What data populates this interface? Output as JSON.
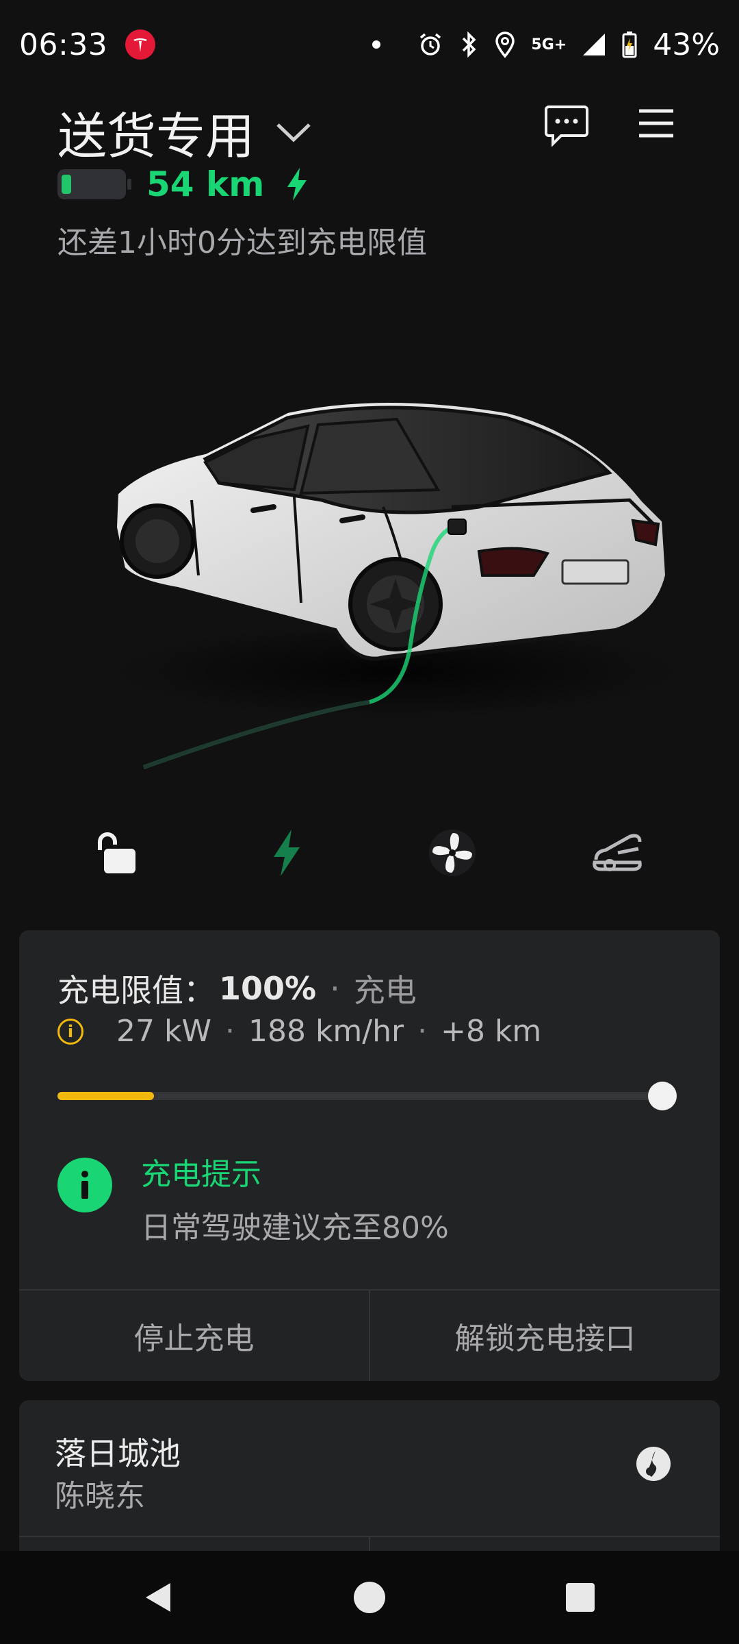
{
  "status_bar": {
    "time": "06:33",
    "network": "5G+",
    "battery_percent": "43%",
    "icons": [
      "tesla-app-icon",
      "dot-icon",
      "alarm-icon",
      "bluetooth-icon",
      "location-icon",
      "signal-icon",
      "battery-icon"
    ]
  },
  "header": {
    "vehicle_name": "送货专用",
    "range": "54 km",
    "charge_eta": "还差1小时0分达到充电限值"
  },
  "quick_controls": {
    "icons": [
      "unlock-icon",
      "charge-icon",
      "fan-icon",
      "trunk-icon"
    ]
  },
  "charging": {
    "limit_label": "充电限值：",
    "limit_value": "100%",
    "status": "充电",
    "power": "27 kW",
    "rate": "188 km/hr",
    "added": "+8 km",
    "current_level_fraction": 0.16,
    "limit_fraction": 1.0,
    "tip_title": "充电提示",
    "tip_body": "日常驾驶建议充至80%",
    "stop_button": "停止充电",
    "unlock_port_button": "解锁充电接口"
  },
  "media": {
    "title": "落日城池",
    "artist": "陈晓东",
    "source_icon": "music-source-icon"
  },
  "colors": {
    "accent_green": "#1ad574",
    "charge_yellow": "#f0b90b",
    "background": "#111112",
    "card": "#222325"
  }
}
